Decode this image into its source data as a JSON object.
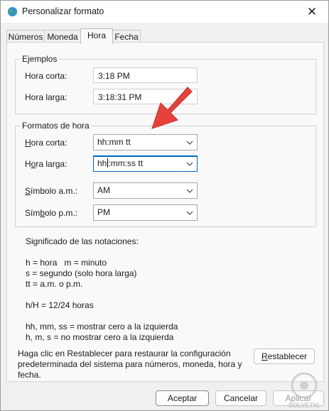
{
  "window": {
    "title": "Personalizar formato",
    "close_glyph": "✕"
  },
  "tabs": [
    {
      "label": "Números"
    },
    {
      "label": "Moneda"
    },
    {
      "label": "Hora",
      "active": true
    },
    {
      "label": "Fecha"
    }
  ],
  "examples": {
    "legend": "Ejemplos",
    "short_label": "Hora corta:",
    "short_value": "3:18 PM",
    "long_label": "Hora larga:",
    "long_value": "3:18:31 PM"
  },
  "formats": {
    "legend": "Formatos de hora",
    "short_label": "Hora corta:",
    "short_value": "hh:mm tt",
    "long_label": "Hora larga:",
    "long_value_pre": "hh",
    "long_value_post": ":mm:ss tt",
    "am_label": "Símbolo a.m.:",
    "am_value": "AM",
    "pm_label": "Símbolo p.m.:",
    "pm_value": "PM"
  },
  "notes": {
    "heading": "Significado de las notaciones:",
    "l1": "h = hora   m = minuto",
    "l2": "s = segundo (solo hora larga)",
    "l3": "tt = a.m. o p.m.",
    "l4": "h/H = 12/24 horas",
    "l5": "hh, mm, ss = mostrar cero a la izquierda",
    "l6": "h, m, s = no mostrar cero a la izquierda"
  },
  "reset": {
    "text1": "Haga clic en Restablecer para restaurar la configuración",
    "text2": "predeterminada del sistema para números, moneda, hora y",
    "text3": "fecha.",
    "button": "Restablecer"
  },
  "footer": {
    "ok": "Aceptar",
    "cancel": "Cancelar",
    "apply": "Aplicar"
  },
  "watermark": {
    "text": "SOLVETIC"
  },
  "colors": {
    "arrow": "#e8413c",
    "focus": "#0067c0"
  }
}
